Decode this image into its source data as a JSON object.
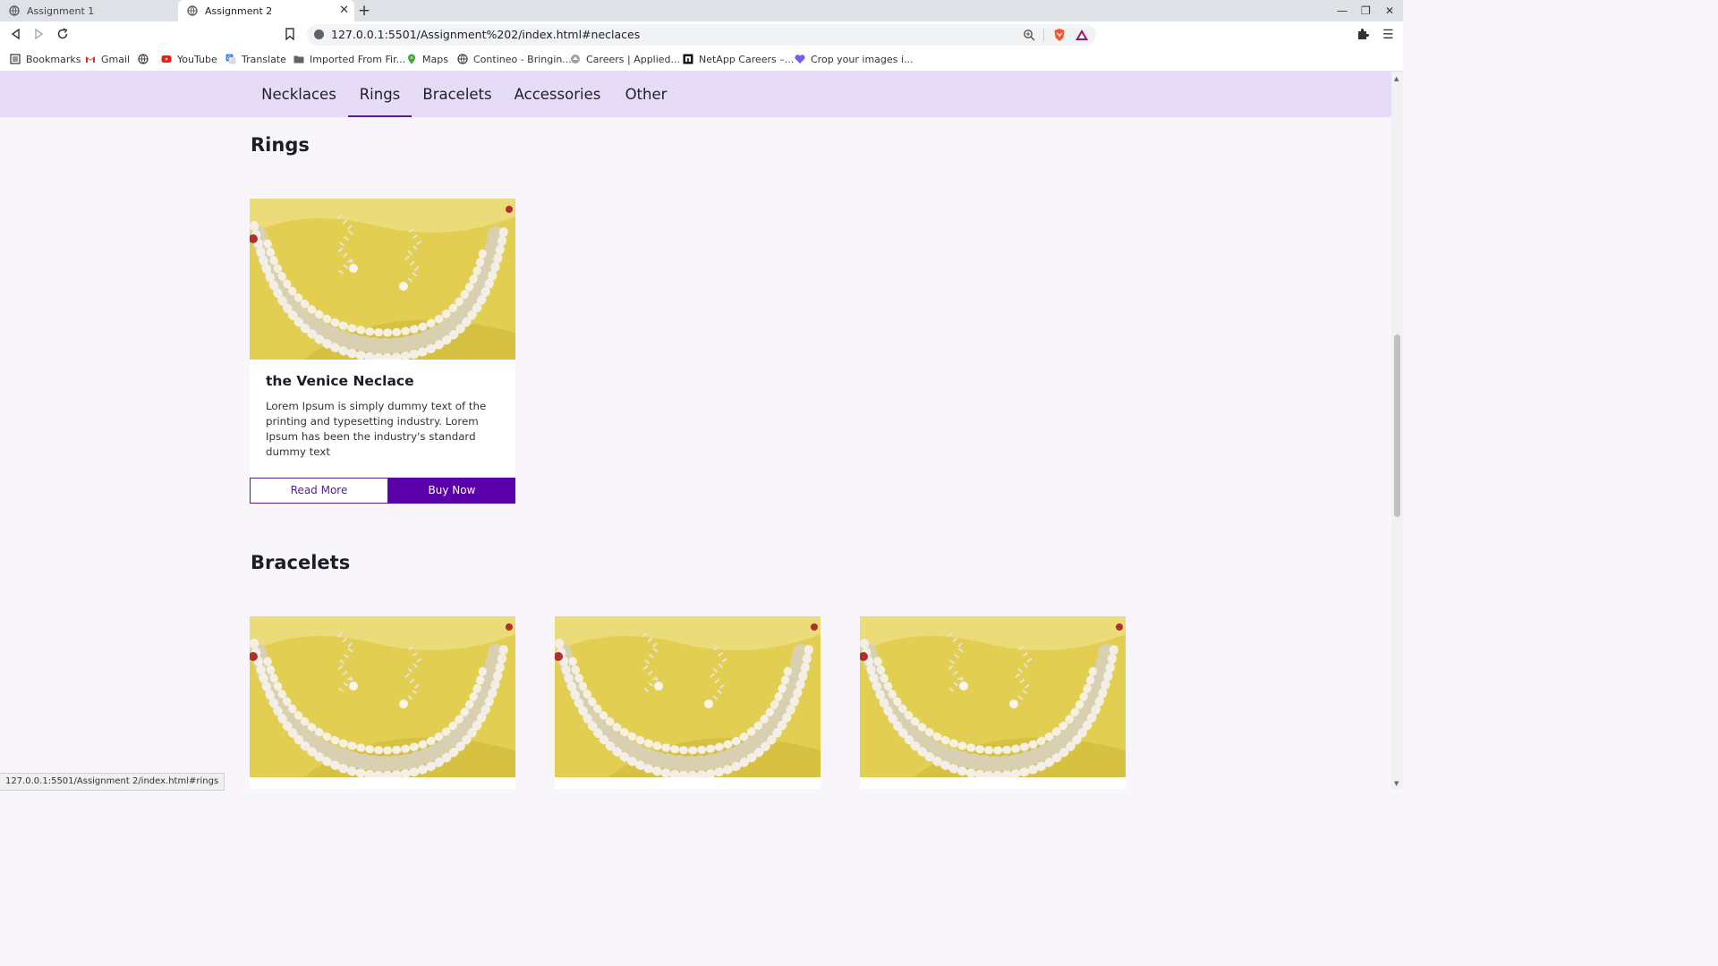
{
  "browser": {
    "tabs": [
      {
        "label": "Assignment 1"
      },
      {
        "label": "Assignment 2"
      }
    ],
    "url": "127.0.0.1:5501/Assignment%202/index.html#neclaces",
    "bookmarks": [
      {
        "label": "Bookmarks",
        "icon": "bookmarks-icon"
      },
      {
        "label": "Gmail",
        "icon": "gmail-icon"
      },
      {
        "label": "",
        "icon": "globe-icon"
      },
      {
        "label": "YouTube",
        "icon": "youtube-icon"
      },
      {
        "label": "Translate",
        "icon": "translate-icon"
      },
      {
        "label": "Imported From Fir...",
        "icon": "folder-icon"
      },
      {
        "label": "Maps",
        "icon": "maps-icon"
      },
      {
        "label": "Contineo - Bringin...",
        "icon": "globe-icon"
      },
      {
        "label": "Careers | Applied...",
        "icon": "careers-icon"
      },
      {
        "label": "NetApp Careers –...",
        "icon": "netapp-icon"
      },
      {
        "label": "Crop your images i...",
        "icon": "heart-icon"
      }
    ],
    "status_url": "127.0.0.1:5501/Assignment 2/index.html#rings"
  },
  "nav": {
    "items": [
      {
        "label": "Necklaces"
      },
      {
        "label": "Rings"
      },
      {
        "label": "Bracelets"
      },
      {
        "label": "Accessories"
      },
      {
        "label": "Other"
      }
    ],
    "active": "Rings"
  },
  "sections": [
    {
      "title": "Rings",
      "cards": [
        {
          "title": "the Venice Neclace",
          "description": "Lorem Ipsum is simply dummy text of the printing and typesetting industry. Lorem Ipsum has been the industry's standard dummy text",
          "read_more": "Read More",
          "buy_now": "Buy Now"
        }
      ]
    },
    {
      "title": "Bracelets"
    }
  ],
  "colors": {
    "nav_bg": "#e6dcf7",
    "accent": "#5a00a8",
    "page_bg": "#f8f6fb",
    "image_bg": "#e3cf4a"
  }
}
